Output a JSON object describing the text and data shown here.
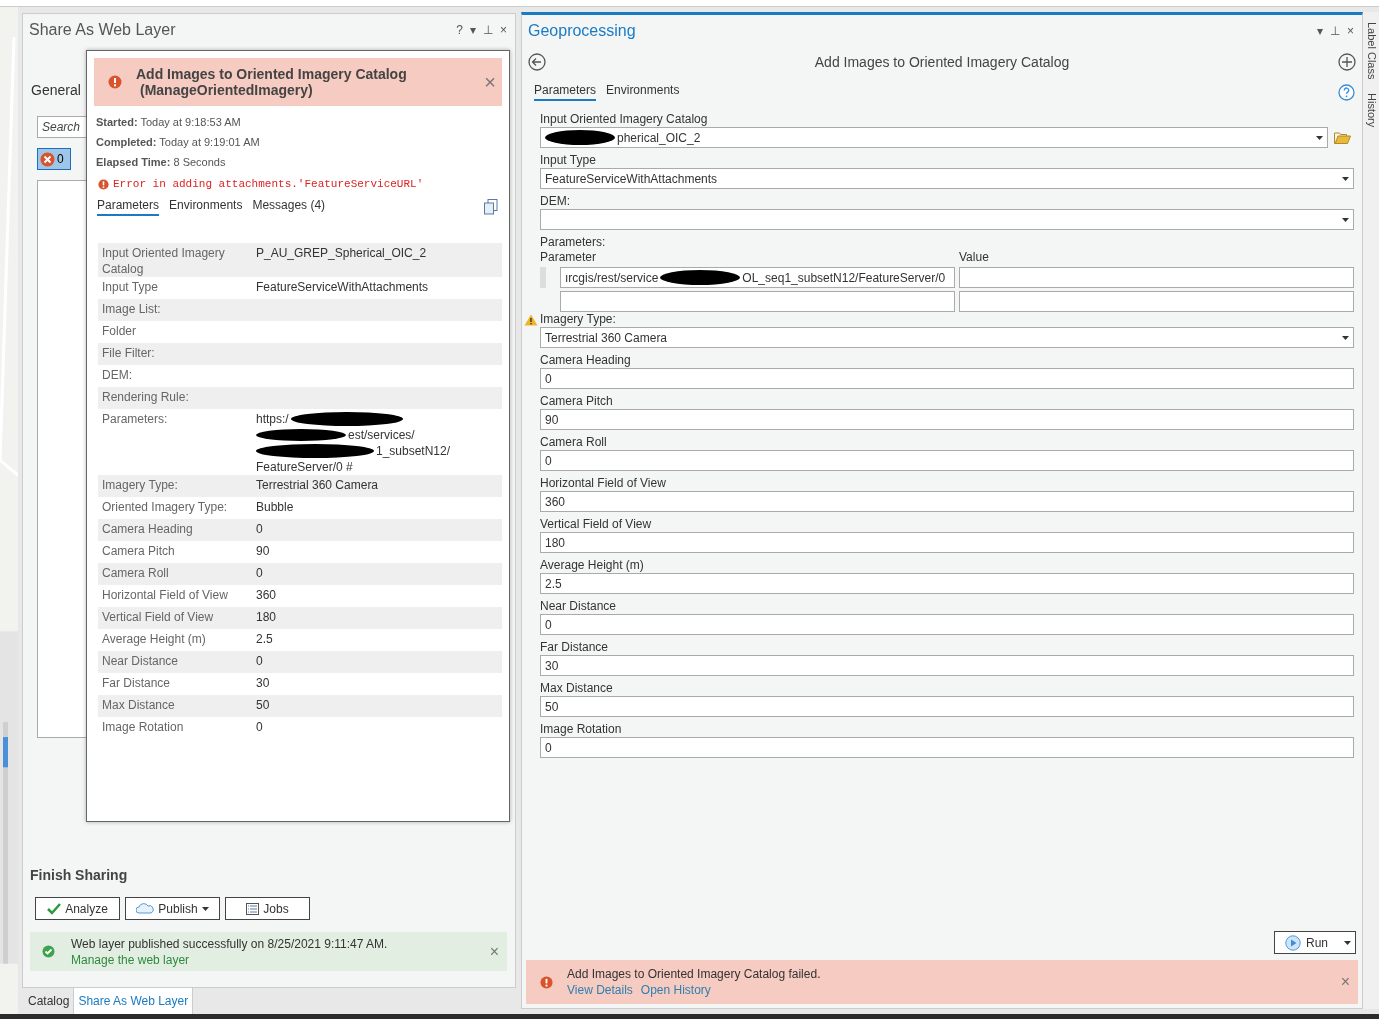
{
  "share_pane": {
    "title": "Share As Web Layer",
    "header_buttons": [
      "?",
      "▾",
      "⊥",
      "×"
    ],
    "section": "General",
    "search": {
      "placeholder": "Search"
    },
    "error_filter": {
      "count": "0",
      "selected": true
    },
    "finish_title": "Finish Sharing",
    "buttons": [
      {
        "kind": "analyze",
        "label": "Analyze"
      },
      {
        "kind": "publish",
        "label": "Publish"
      },
      {
        "kind": "jobs",
        "label": "Jobs"
      }
    ],
    "success": {
      "message": "Web layer published successfully on 8/25/2021 9:11:47 AM.",
      "link": "Manage the web layer",
      "close": "×"
    }
  },
  "bottom_tabs": [
    {
      "label": "Catalog",
      "selected": false
    },
    {
      "label": "Share As Web Layer",
      "selected": true
    }
  ],
  "details_popup": {
    "title": "Add Images to Oriented Imagery Catalog",
    "subtitle": "(ManageOrientedImagery)",
    "close": "×",
    "info": [
      {
        "label": "Started:",
        "value": "Today at 9:18:53 AM"
      },
      {
        "label": "Completed:",
        "value": "Today at 9:19:01 AM"
      },
      {
        "label": "Elapsed Time:",
        "value": "8 Seconds"
      }
    ],
    "error": "Error in adding attachments.'FeatureServiceURL'",
    "tabs": [
      {
        "label": "Parameters",
        "selected": true
      },
      {
        "label": "Environments",
        "selected": false
      },
      {
        "label": "Messages (4)",
        "selected": false
      }
    ],
    "rows": [
      {
        "label": "Input Oriented Imagery Catalog",
        "value": "P_AU_GREP_Spherical_OIC_2"
      },
      {
        "label": "Input Type",
        "value": "FeatureServiceWithAttachments"
      },
      {
        "label": "Image List:"
      },
      {
        "label": "Folder"
      },
      {
        "label": "File Filter:"
      },
      {
        "label": "DEM:"
      },
      {
        "label": "Rendering Rule:"
      },
      {
        "label": "Parameters:",
        "lines": [
          "https:/",
          "est/services/",
          "1_subsetN12/",
          "FeatureServer/0 #"
        ],
        "redacted": true
      },
      {
        "label": "Imagery Type:",
        "value": "Terrestrial 360 Camera"
      },
      {
        "label": "Oriented Imagery Type:",
        "value": "Bubble"
      },
      {
        "label": "Camera Heading",
        "value": "0"
      },
      {
        "label": "Camera Pitch",
        "value": "90"
      },
      {
        "label": "Camera Roll",
        "value": "0"
      },
      {
        "label": "Horizontal Field of View",
        "value": "360"
      },
      {
        "label": "Vertical Field of View",
        "value": "180"
      },
      {
        "label": "Average Height (m)",
        "value": "2.5"
      },
      {
        "label": "Near Distance",
        "value": "0"
      },
      {
        "label": "Far Distance",
        "value": "30"
      },
      {
        "label": "Max Distance",
        "value": "50"
      },
      {
        "label": "Image Rotation",
        "value": "0"
      }
    ]
  },
  "geoprocessing": {
    "title": "Geoprocessing",
    "header_buttons": [
      "▾",
      "⊥",
      "×"
    ],
    "tool_title": "Add Images to Oriented Imagery Catalog",
    "tabs": [
      {
        "label": "Parameters",
        "selected": true
      },
      {
        "label": "Environments",
        "selected": false
      }
    ],
    "params": [
      {
        "kind": "dataset",
        "label": "Input Oriented Imagery Catalog",
        "value": "pherical_OIC_2",
        "redacted": true
      },
      {
        "kind": "dropdown",
        "label": "Input Type",
        "value": "FeatureServiceWithAttachments"
      },
      {
        "kind": "dropdown",
        "label": "DEM:"
      },
      {
        "kind": "table",
        "label": "Parameters:",
        "columns": [
          "Parameter",
          "Value"
        ],
        "parts": [
          "ırcgis/rest/service",
          "OL_seq1_subsetN12/FeatureServer/0"
        ]
      },
      {
        "kind": "dropdown",
        "label": "Imagery Type:",
        "value": "Terrestrial 360 Camera",
        "warning": true
      },
      {
        "kind": "text",
        "label": "Camera Heading",
        "value": "0"
      },
      {
        "kind": "text",
        "label": "Camera Pitch",
        "value": "90"
      },
      {
        "kind": "text",
        "label": "Camera Roll",
        "value": "0"
      },
      {
        "kind": "text",
        "label": "Horizontal Field of View",
        "value": "360"
      },
      {
        "kind": "text",
        "label": "Vertical Field of View",
        "value": "180"
      },
      {
        "kind": "text",
        "label": "Average Height (m)",
        "value": "2.5"
      },
      {
        "kind": "text",
        "label": "Near Distance",
        "value": "0"
      },
      {
        "kind": "text",
        "label": "Far Distance",
        "value": "30"
      },
      {
        "kind": "text",
        "label": "Max Distance",
        "value": "50"
      },
      {
        "kind": "text",
        "label": "Image Rotation",
        "value": "0"
      }
    ],
    "run": "Run",
    "failure": {
      "message": "Add Images to Oriented Imagery Catalog failed.",
      "links": [
        "View Details",
        "Open History"
      ],
      "close": "×"
    }
  },
  "side_tabs": [
    "Label Class",
    "History"
  ]
}
